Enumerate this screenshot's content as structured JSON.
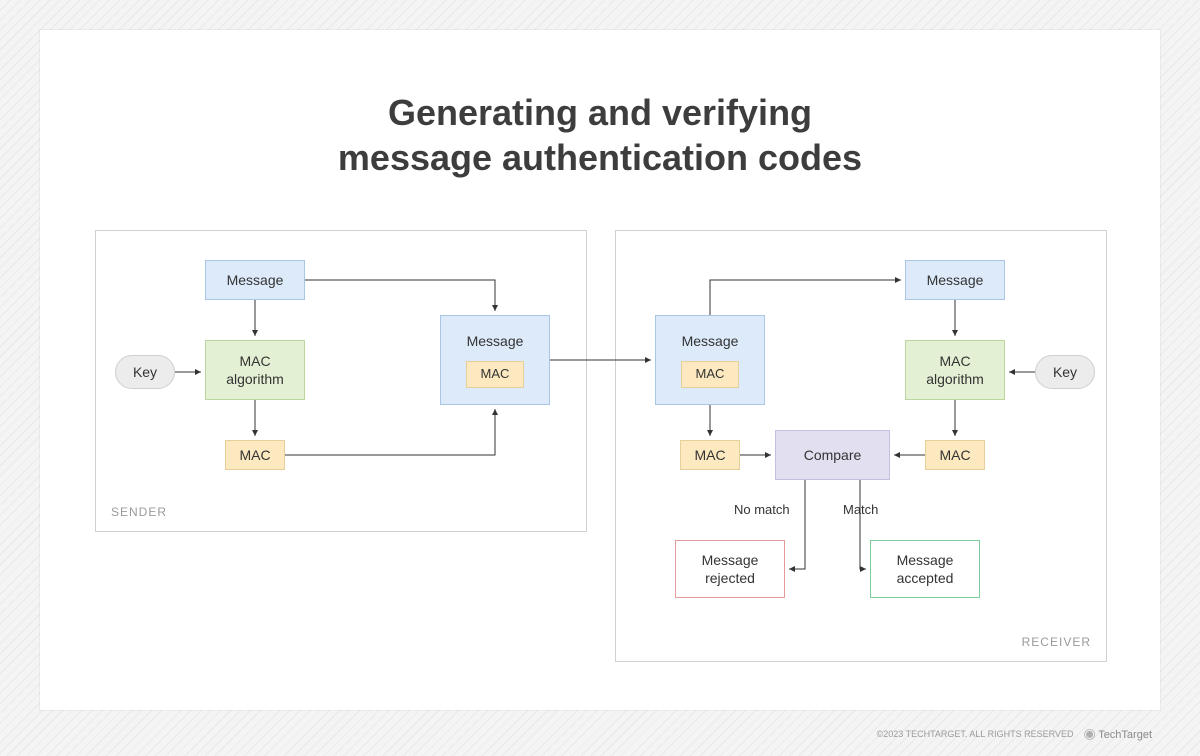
{
  "title_line1": "Generating and verifying",
  "title_line2": "message authentication codes",
  "sender_label": "SENDER",
  "receiver_label": "RECEIVER",
  "labels": {
    "message": "Message",
    "mac_algorithm": "MAC\nalgorithm",
    "mac": "MAC",
    "key": "Key",
    "compare": "Compare",
    "no_match": "No match",
    "match": "Match",
    "msg_rejected": "Message\nrejected",
    "msg_accepted": "Message\naccepted"
  },
  "footer": {
    "copyright": "©2023 TECHTARGET. ALL RIGHTS RESERVED",
    "brand": "TechTarget"
  },
  "colors": {
    "msg": "#dceaf9",
    "alg": "#e4f0d3",
    "mac": "#fce9c0",
    "key": "#ececec",
    "compare": "#e2dff0",
    "accept_border": "#7ccf9a",
    "reject_border": "#e79a9a"
  }
}
